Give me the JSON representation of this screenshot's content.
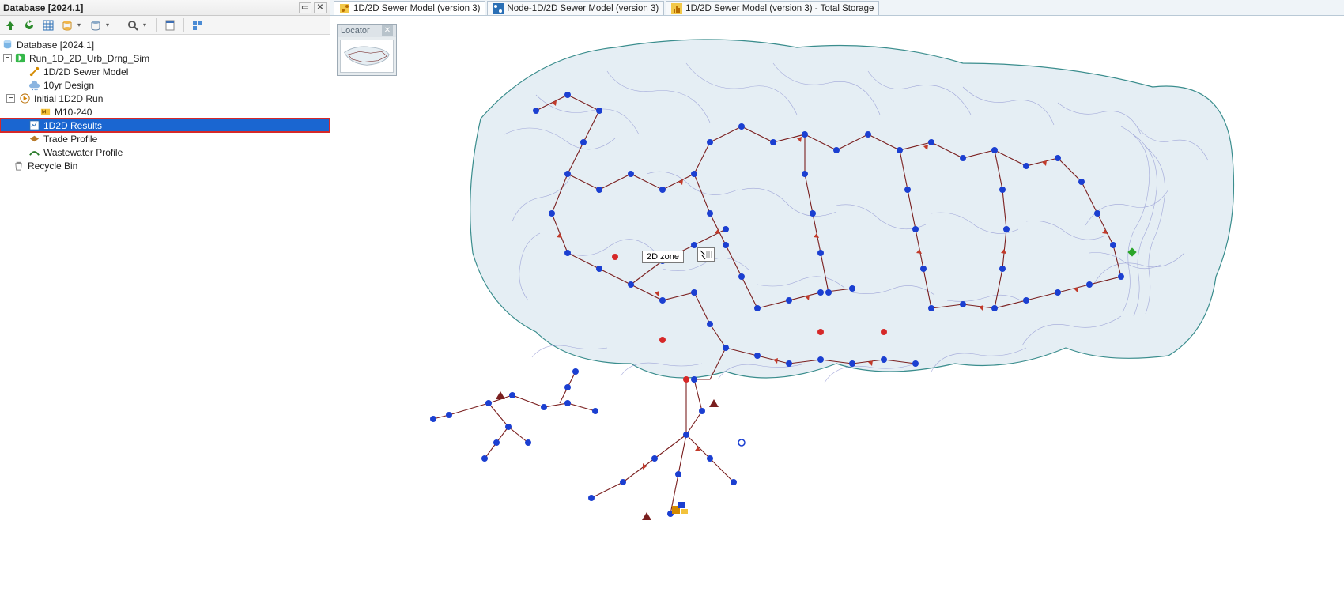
{
  "panel": {
    "title": "Database [2024.1]",
    "close_tip": "Close",
    "pin_tip": "Pin"
  },
  "toolbar": {
    "buttons": [
      "up",
      "refresh",
      "grid",
      "db",
      "db2",
      "search",
      "doc",
      "cfg"
    ]
  },
  "tree": {
    "root": "Database [2024.1]",
    "run": "Run_1D_2D_Urb_Drng_Sim",
    "sewer_model": "1D/2D Sewer Model",
    "design": "10yr Design",
    "initial_run": "Initial 1D2D Run",
    "m10": "M10-240",
    "results": "1D2D Results",
    "trade_profile": "Trade Profile",
    "waste_profile": "Wastewater Profile",
    "recycle": "Recycle Bin"
  },
  "tabs": {
    "t1": "1D/2D Sewer Model (version 3)",
    "t2": "Node-1D/2D Sewer Model (version 3)",
    "t3": "1D/2D Sewer Model (version 3) - Total Storage"
  },
  "locator": {
    "title": "Locator"
  },
  "tooltip": {
    "label": "2D zone"
  },
  "cursor_badge": "↯"
}
